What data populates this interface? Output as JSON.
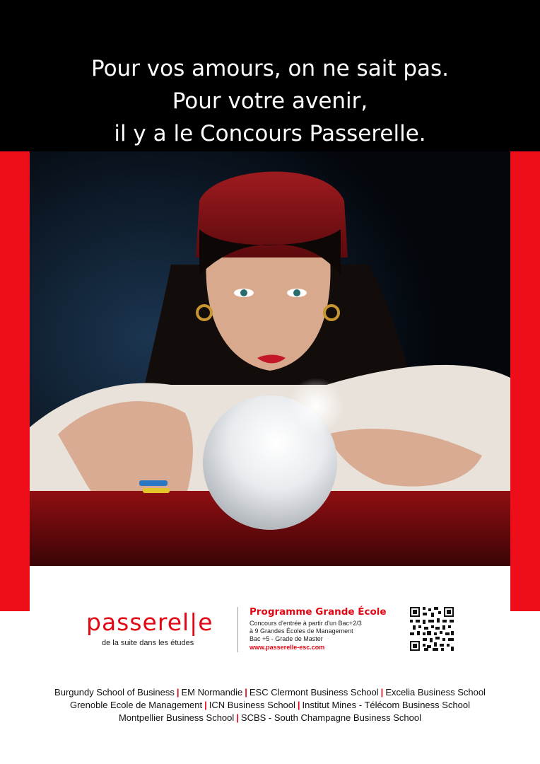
{
  "headline": {
    "line1": "Pour vos amours, on ne sait pas.",
    "line2": "Pour votre avenir,",
    "line3": "il y a le Concours Passerelle."
  },
  "brand": {
    "name": "passerel|e",
    "tagline": "de la suite dans les études"
  },
  "program": {
    "title": "Programme Grande École",
    "line1": "Concours d'entrée à partir d'un Bac+2/3",
    "line2": "à 9 Grandes Écoles de Management",
    "line3": "Bac +5 - Grade de Master",
    "url": "www.passerelle-esc.com"
  },
  "schools": {
    "separator": "|",
    "rows": [
      [
        "Burgundy School of Business",
        "EM Normandie",
        "ESC Clermont Business School",
        "Excelia Business School"
      ],
      [
        "Grenoble Ecole de Management",
        "ICN Business School",
        "Institut Mines - Télécom Business School"
      ],
      [
        "Montpellier Business School",
        "SCBS - South Champagne Business School"
      ]
    ]
  },
  "colors": {
    "brand_red": "#e30613",
    "band_red": "#ee0e1a",
    "top_band": "#000000"
  },
  "photo": {
    "subject": "fortune-teller-with-crystal-ball"
  }
}
